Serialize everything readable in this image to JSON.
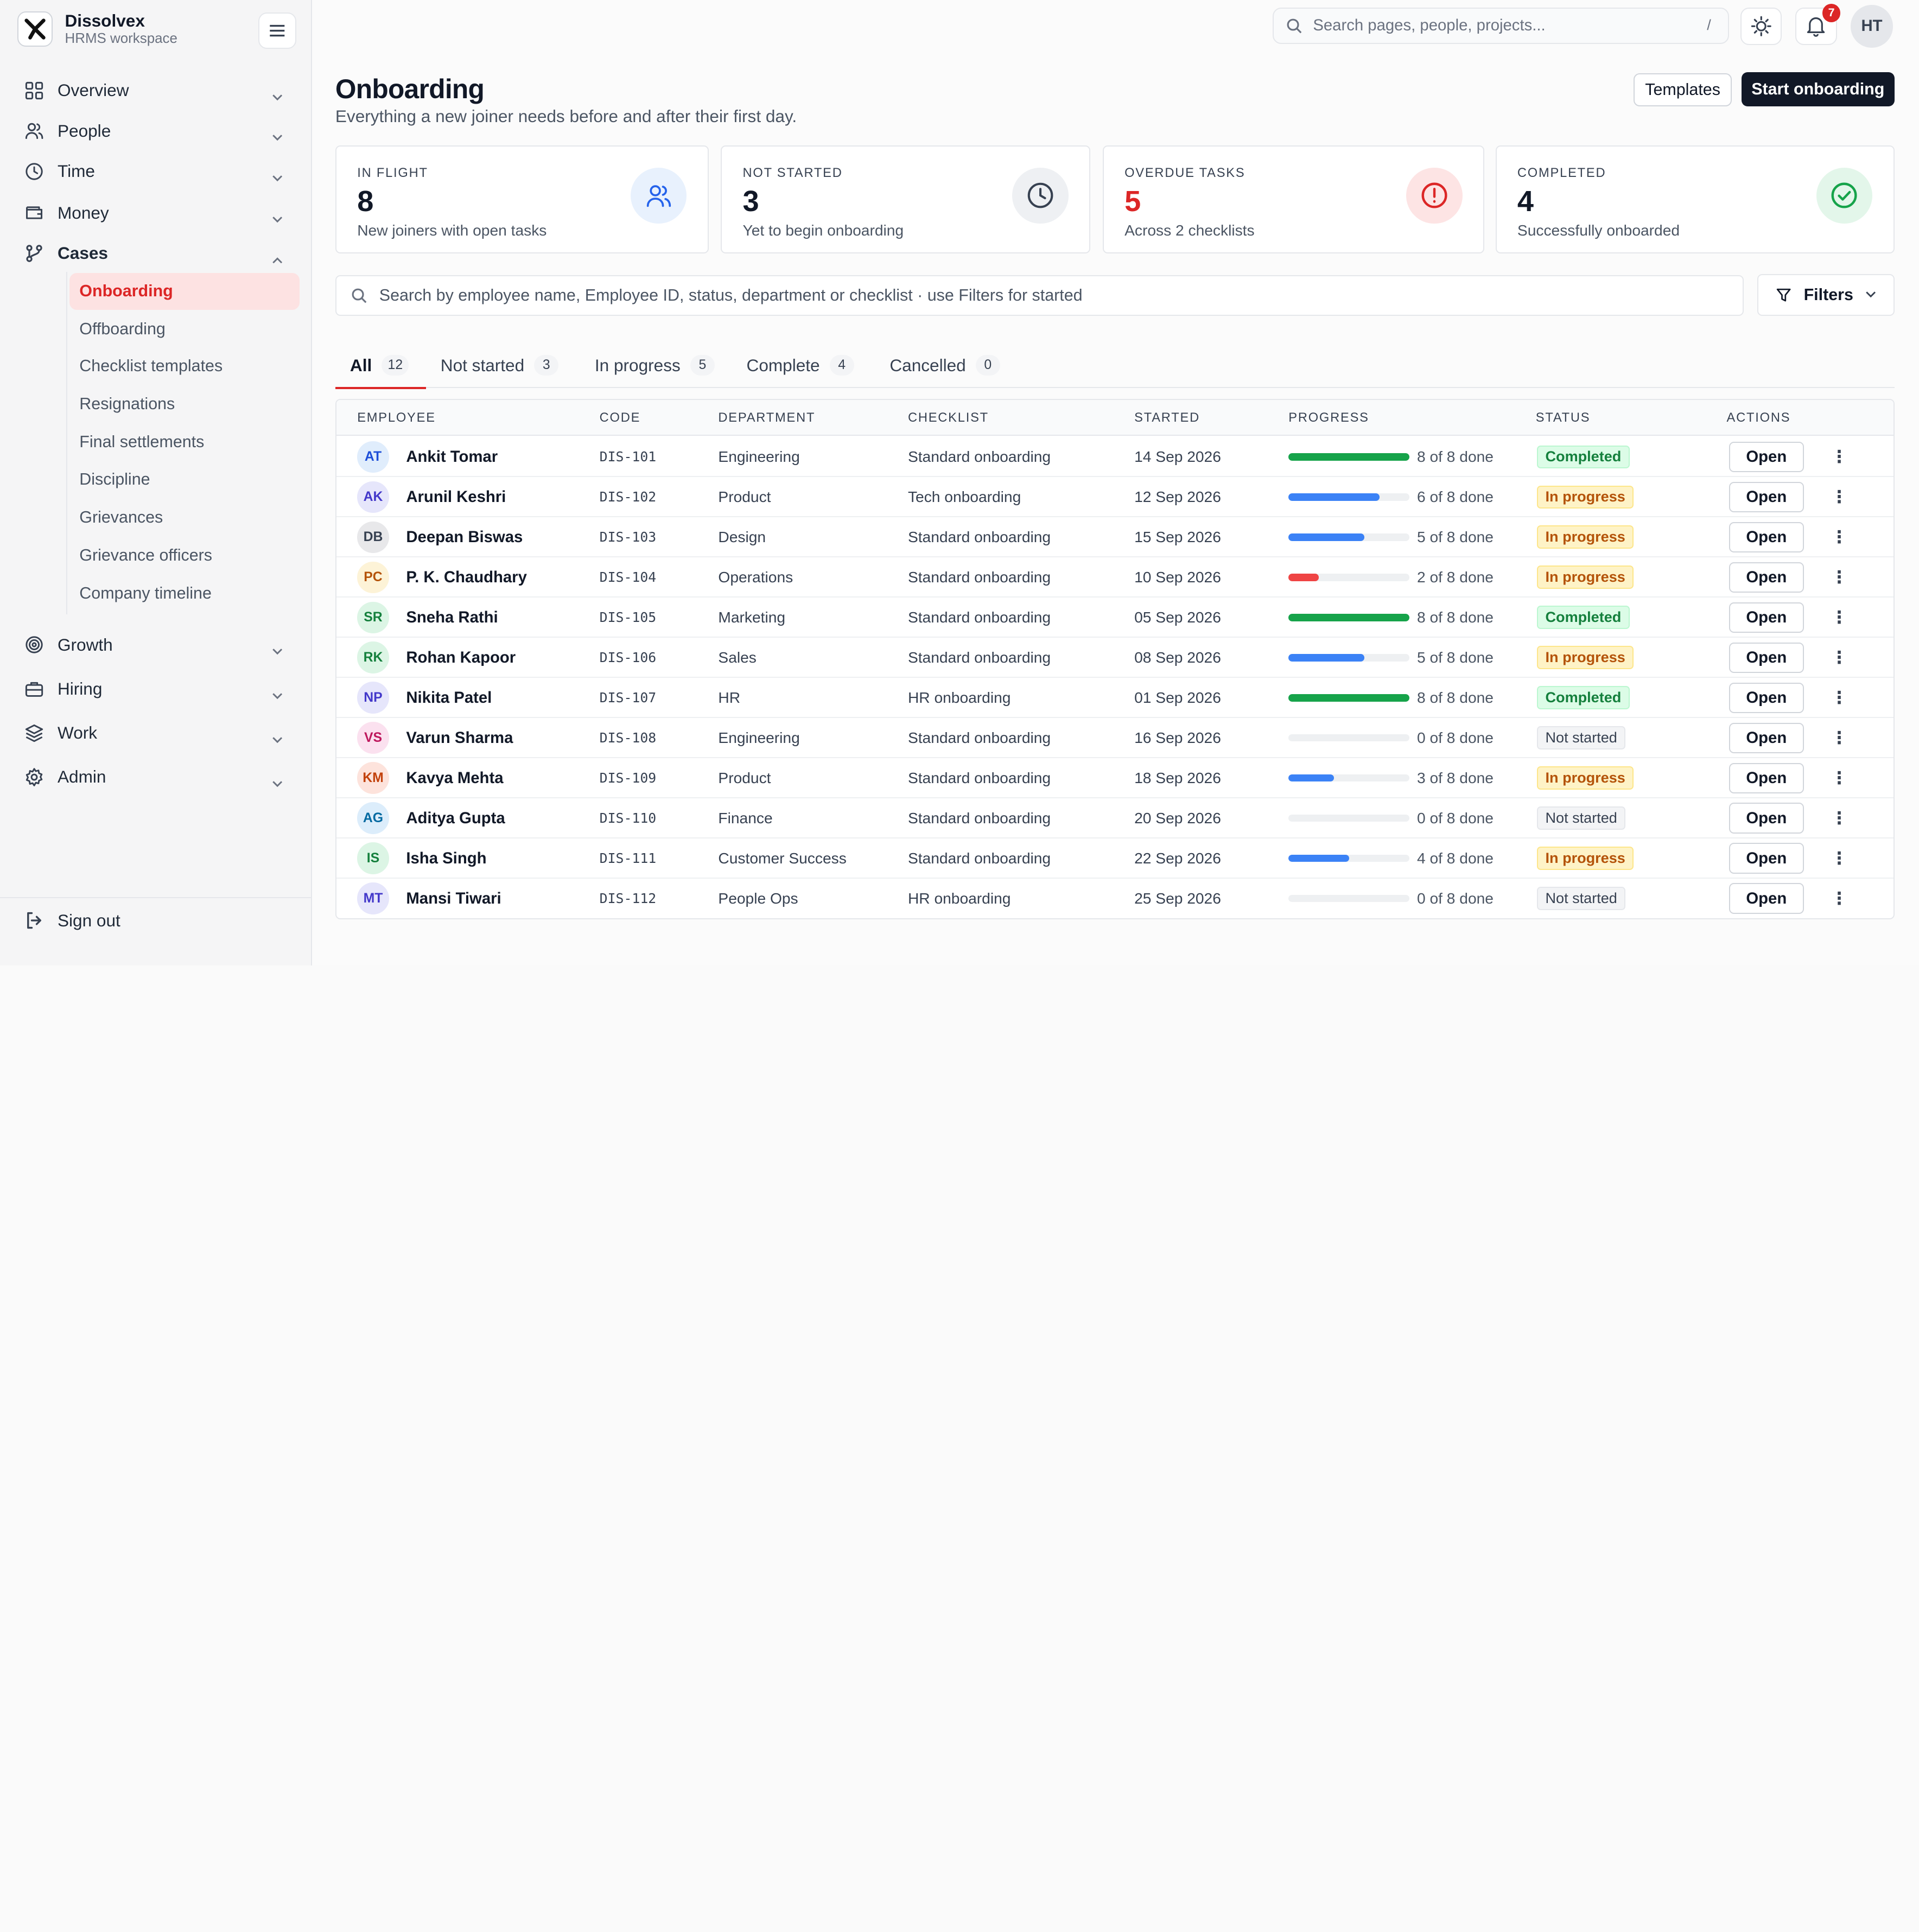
{
  "brand": {
    "name": "Dissolvex",
    "subtitle": "HRMS workspace"
  },
  "sidebar": {
    "nav": [
      {
        "label": "Overview",
        "icon": "grid-icon",
        "expanded": false
      },
      {
        "label": "People",
        "icon": "users-icon",
        "expanded": false
      },
      {
        "label": "Time",
        "icon": "clock-icon",
        "expanded": false
      },
      {
        "label": "Money",
        "icon": "wallet-icon",
        "expanded": false
      },
      {
        "label": "Cases",
        "icon": "branch-icon",
        "expanded": true
      },
      {
        "label": "Growth",
        "icon": "target-icon",
        "expanded": false
      },
      {
        "label": "Hiring",
        "icon": "briefcase-icon",
        "expanded": false
      },
      {
        "label": "Work",
        "icon": "layers-icon",
        "expanded": false
      },
      {
        "label": "Admin",
        "icon": "gear-icon",
        "expanded": false
      }
    ],
    "cases_sub": [
      {
        "label": "Onboarding",
        "active": true
      },
      {
        "label": "Offboarding"
      },
      {
        "label": "Checklist templates"
      },
      {
        "label": "Resignations"
      },
      {
        "label": "Final settlements"
      },
      {
        "label": "Discipline"
      },
      {
        "label": "Grievances"
      },
      {
        "label": "Grievance officers"
      },
      {
        "label": "Company timeline"
      }
    ],
    "sign_out": "Sign out"
  },
  "topbar": {
    "search_placeholder": "Search pages, people, projects...",
    "search_shortcut": "/",
    "notifications_count": "7",
    "user_initials": "HT"
  },
  "page": {
    "title": "Onboarding",
    "subtitle": "Everything a new joiner needs before and after their first day.",
    "templates_button": "Templates",
    "start_button": "Start onboarding"
  },
  "stats": [
    {
      "caption": "IN FLIGHT",
      "value": "8",
      "desc": "New joiners with open tasks",
      "icon": "users-icon",
      "color": "#2563eb",
      "bg": "#e8f1fd"
    },
    {
      "caption": "NOT STARTED",
      "value": "3",
      "desc": "Yet to begin onboarding",
      "icon": "clock-icon",
      "color": "#374151",
      "bg": "#eef0f3"
    },
    {
      "caption": "OVERDUE TASKS",
      "value": "5",
      "desc": "Across 2 checklists",
      "icon": "alert-icon",
      "color": "#dc2626",
      "bg": "#fde4e4",
      "red": true
    },
    {
      "caption": "COMPLETED",
      "value": "4",
      "desc": "Successfully onboarded",
      "icon": "check-circle-icon",
      "color": "#16a34a",
      "bg": "#e3f6ea"
    }
  ],
  "search": {
    "placeholder": "Search by employee name, Employee ID, status, department or checklist · use Filters for started"
  },
  "filters_label": "Filters",
  "tabs": [
    {
      "label": "All",
      "count": "12",
      "active": true
    },
    {
      "label": "Not started",
      "count": "3"
    },
    {
      "label": "In progress",
      "count": "5"
    },
    {
      "label": "Complete",
      "count": "4"
    },
    {
      "label": "Cancelled",
      "count": "0"
    }
  ],
  "table": {
    "headers": [
      "EMPLOYEE",
      "CODE",
      "DEPARTMENT",
      "CHECKLIST",
      "STARTED",
      "PROGRESS",
      "STATUS",
      "ACTIONS"
    ],
    "open_label": "Open",
    "rows": [
      {
        "initials": "AT",
        "name": "Ankit Tomar",
        "code": "DIS-101",
        "dept": "Engineering",
        "checklist": "Standard onboarding",
        "started": "14 Sep 2026",
        "done": 8,
        "total": 8,
        "progress": "8 of 8 done",
        "status": "Completed",
        "avbg": "#e0edfc",
        "avfg": "#1d4ed8"
      },
      {
        "initials": "AK",
        "name": "Arunil Keshri",
        "code": "DIS-102",
        "dept": "Product",
        "checklist": "Tech onboarding",
        "started": "12 Sep 2026",
        "done": 6,
        "total": 8,
        "progress": "6 of 8 done",
        "status": "In progress",
        "avbg": "#e6e6fb",
        "avfg": "#4338ca"
      },
      {
        "initials": "DB",
        "name": "Deepan Biswas",
        "code": "DIS-103",
        "dept": "Design",
        "checklist": "Standard onboarding",
        "started": "15 Sep 2026",
        "done": 5,
        "total": 8,
        "progress": "5 of 8 done",
        "status": "In progress",
        "avbg": "#e8e8ea",
        "avfg": "#374151"
      },
      {
        "initials": "PC",
        "name": "P. K. Chaudhary",
        "code": "DIS-104",
        "dept": "Operations",
        "checklist": "Standard onboarding",
        "started": "10 Sep 2026",
        "done": 2,
        "total": 8,
        "progress": "2 of 8 done",
        "status": "In progress",
        "avbg": "#fdf3d7",
        "avfg": "#b45309"
      },
      {
        "initials": "SR",
        "name": "Sneha Rathi",
        "code": "DIS-105",
        "dept": "Marketing",
        "checklist": "Standard onboarding",
        "started": "05 Sep 2026",
        "done": 8,
        "total": 8,
        "progress": "8 of 8 done",
        "status": "Completed",
        "avbg": "#dcf5e5",
        "avfg": "#15803d"
      },
      {
        "initials": "RK",
        "name": "Rohan Kapoor",
        "code": "DIS-106",
        "dept": "Sales",
        "checklist": "Standard onboarding",
        "started": "08 Sep 2026",
        "done": 5,
        "total": 8,
        "progress": "5 of 8 done",
        "status": "In progress",
        "avbg": "#dcf5e5",
        "avfg": "#15803d"
      },
      {
        "initials": "NP",
        "name": "Nikita Patel",
        "code": "DIS-107",
        "dept": "HR",
        "checklist": "HR onboarding",
        "started": "01 Sep 2026",
        "done": 8,
        "total": 8,
        "progress": "8 of 8 done",
        "status": "Completed",
        "avbg": "#e6e6fb",
        "avfg": "#4338ca"
      },
      {
        "initials": "VS",
        "name": "Varun Sharma",
        "code": "DIS-108",
        "dept": "Engineering",
        "checklist": "Standard onboarding",
        "started": "16 Sep 2026",
        "done": 0,
        "total": 8,
        "progress": "0 of 8 done",
        "status": "Not started",
        "avbg": "#fbe1ef",
        "avfg": "#be185d"
      },
      {
        "initials": "KM",
        "name": "Kavya Mehta",
        "code": "DIS-109",
        "dept": "Product",
        "checklist": "Standard onboarding",
        "started": "18 Sep 2026",
        "done": 3,
        "total": 8,
        "progress": "3 of 8 done",
        "status": "In progress",
        "avbg": "#fde3dc",
        "avfg": "#c2410c"
      },
      {
        "initials": "AG",
        "name": "Aditya Gupta",
        "code": "DIS-110",
        "dept": "Finance",
        "checklist": "Standard onboarding",
        "started": "20 Sep 2026",
        "done": 0,
        "total": 8,
        "progress": "0 of 8 done",
        "status": "Not started",
        "avbg": "#dcedfb",
        "avfg": "#0369a1"
      },
      {
        "initials": "IS",
        "name": "Isha Singh",
        "code": "DIS-111",
        "dept": "Customer Success",
        "checklist": "Standard onboarding",
        "started": "22 Sep 2026",
        "done": 4,
        "total": 8,
        "progress": "4 of 8 done",
        "status": "In progress",
        "avbg": "#dcf5e5",
        "avfg": "#15803d"
      },
      {
        "initials": "MT",
        "name": "Mansi Tiwari",
        "code": "DIS-112",
        "dept": "People Ops",
        "checklist": "HR onboarding",
        "started": "25 Sep 2026",
        "done": 0,
        "total": 8,
        "progress": "0 of 8 done",
        "status": "Not started",
        "avbg": "#e6e6fb",
        "avfg": "#4338ca"
      }
    ]
  },
  "colors": {
    "accent": "#dc2626",
    "bar_green": "#16a34a",
    "bar_blue": "#3b82f6",
    "bar_red": "#ef4444"
  }
}
